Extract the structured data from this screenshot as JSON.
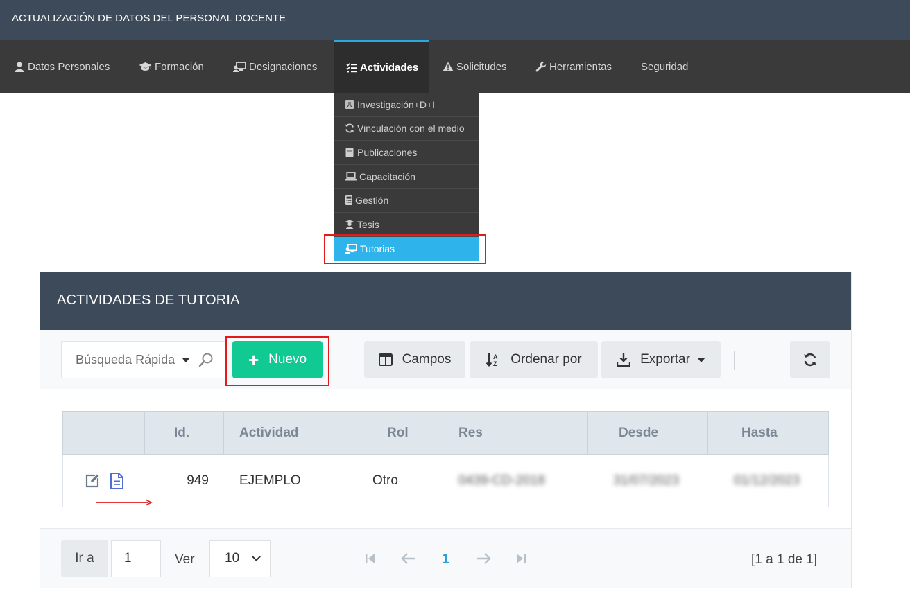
{
  "app": {
    "title": "ACTUALIZACIÓN DE DATOS DEL PERSONAL DOCENTE"
  },
  "nav": {
    "items": [
      {
        "label": "Datos Personales",
        "icon": "user-icon"
      },
      {
        "label": "Formación",
        "icon": "graduation-cap-icon"
      },
      {
        "label": "Designaciones",
        "icon": "chalkboard-teacher-icon"
      },
      {
        "label": "Actividades",
        "icon": "tasks-list-icon",
        "active": true
      },
      {
        "label": "Solicitudes",
        "icon": "warning-icon"
      },
      {
        "label": "Herramientas",
        "icon": "wrench-icon"
      },
      {
        "label": "Seguridad",
        "icon": ""
      }
    ]
  },
  "dropdown": {
    "items": [
      {
        "label": "Investigación+D+I",
        "icon": "flask-icon"
      },
      {
        "label": "Vinculación con el medio",
        "icon": "refresh-icon"
      },
      {
        "label": "Publicaciones",
        "icon": "book-icon"
      },
      {
        "label": "Capacitación",
        "icon": "laptop-icon"
      },
      {
        "label": "Gestión",
        "icon": "calculator-icon"
      },
      {
        "label": "Tesis",
        "icon": "user-graduate-icon"
      },
      {
        "label": "Tutorias",
        "icon": "chalkboard-teacher-icon",
        "active": true
      }
    ]
  },
  "panel": {
    "title": "ACTIVIDADES DE TUTORIA",
    "toolbar": {
      "search_placeholder": "Búsqueda Rápida",
      "new_label": "Nuevo",
      "fields_label": "Campos",
      "sort_label": "Ordenar por",
      "export_label": "Exportar"
    },
    "table": {
      "columns": [
        "",
        "Id.",
        "Actividad",
        "Rol",
        "Res",
        "Desde",
        "Hasta"
      ],
      "rows": [
        {
          "id": "949",
          "actividad": "EJEMPLO",
          "rol": "Otro",
          "res": "0439-CD-2018",
          "desde": "31/07/2023",
          "hasta": "01/12/2023"
        }
      ]
    },
    "pager": {
      "goto_label": "Ir a",
      "goto_value": "1",
      "view_label": "Ver",
      "page_size": "10",
      "current_page": "1",
      "info": "[1 a 1 de 1]"
    }
  },
  "colors": {
    "header_bg": "#3d4a5a",
    "nav_bg": "#3a3a3a",
    "active_accent": "#2eb3ea",
    "new_button": "#10c993",
    "highlight": "#e21a1a"
  }
}
